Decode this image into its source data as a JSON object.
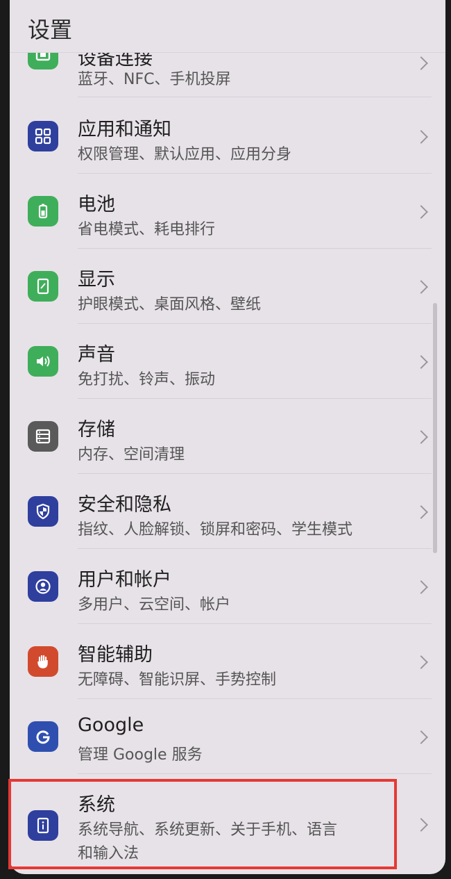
{
  "header": {
    "title": "设置"
  },
  "items": [
    {
      "title": "设备连接",
      "subtitle": "蓝牙、NFC、手机投屏",
      "icon": "device-connection-icon",
      "color": "#3fae5a"
    },
    {
      "title": "应用和通知",
      "subtitle": "权限管理、默认应用、应用分身",
      "icon": "apps-icon",
      "color": "#2f3f9e"
    },
    {
      "title": "电池",
      "subtitle": "省电模式、耗电排行",
      "icon": "battery-icon",
      "color": "#3fae5a"
    },
    {
      "title": "显示",
      "subtitle": "护眼模式、桌面风格、壁纸",
      "icon": "display-icon",
      "color": "#3fae5a"
    },
    {
      "title": "声音",
      "subtitle": "免打扰、铃声、振动",
      "icon": "sound-icon",
      "color": "#3fae5a"
    },
    {
      "title": "存储",
      "subtitle": "内存、空间清理",
      "icon": "storage-icon",
      "color": "#5a5a5a"
    },
    {
      "title": "安全和隐私",
      "subtitle": "指纹、人脸解锁、锁屏和密码、学生模式",
      "icon": "shield-icon",
      "color": "#2f3f9e"
    },
    {
      "title": "用户和帐户",
      "subtitle": "多用户、云空间、帐户",
      "icon": "user-icon",
      "color": "#2f3f9e"
    },
    {
      "title": "智能辅助",
      "subtitle": "无障碍、智能识屏、手势控制",
      "icon": "hand-icon",
      "color": "#d24a2e"
    },
    {
      "title": "Google",
      "subtitle": "管理 Google 服务",
      "icon": "google-icon",
      "color": "#2f4fb0"
    },
    {
      "title": "系统",
      "subtitle": "系统导航、系统更新、关于手机、语言",
      "subtitle2": "和输入法",
      "icon": "system-info-icon",
      "color": "#2f3f9e"
    }
  ]
}
